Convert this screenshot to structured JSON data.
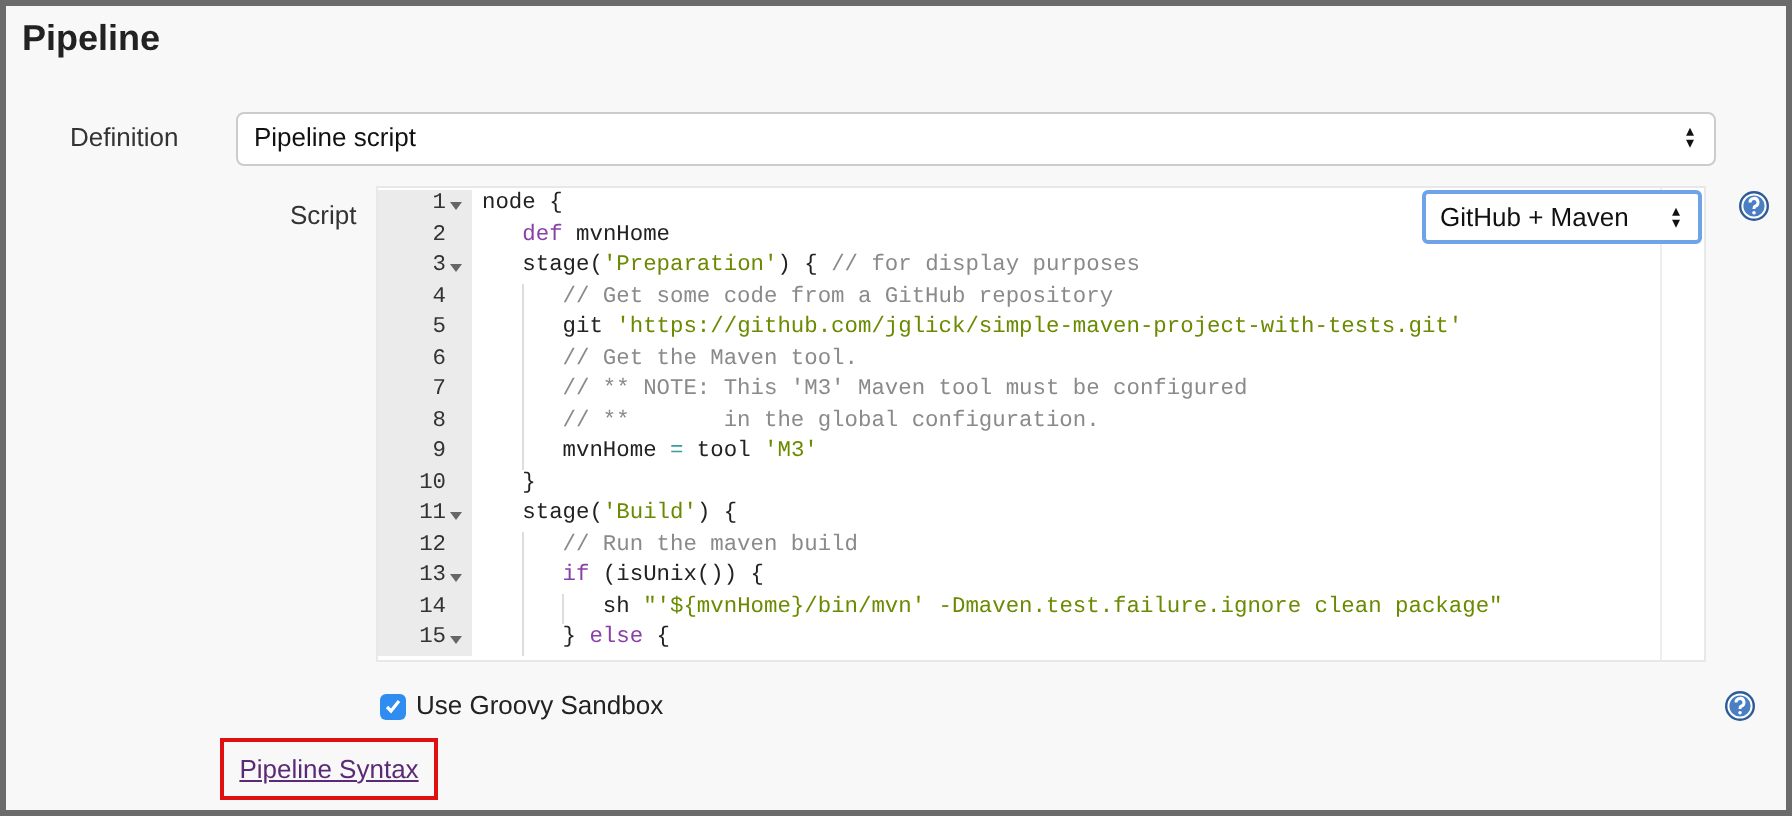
{
  "section": {
    "title": "Pipeline"
  },
  "definition": {
    "label": "Definition",
    "value": "Pipeline script",
    "arrows": "▴▾"
  },
  "script": {
    "label": "Script",
    "template": {
      "value": "GitHub + Maven"
    },
    "lines": [
      {
        "number": "1",
        "fold": true,
        "tokens": [
          {
            "kind": "plain",
            "text": "node {"
          }
        ],
        "children": [
          {
            "number": "2",
            "fold": false,
            "tokens": [
              {
                "kind": "keyword",
                "text": "def"
              },
              {
                "kind": "plain",
                "text": " mvnHome"
              }
            ]
          },
          {
            "number": "3",
            "fold": true,
            "tokens": [
              {
                "kind": "plain",
                "text": "stage("
              },
              {
                "kind": "string",
                "text": "'Preparation'"
              },
              {
                "kind": "plain",
                "text": ") { "
              },
              {
                "kind": "comment",
                "text": "// for display purposes"
              }
            ],
            "children": [
              {
                "number": "4",
                "fold": false,
                "tokens": [
                  {
                    "kind": "comment",
                    "text": "// Get some code from a GitHub repository"
                  }
                ]
              },
              {
                "number": "5",
                "fold": false,
                "tokens": [
                  {
                    "kind": "plain",
                    "text": "git "
                  },
                  {
                    "kind": "string",
                    "text": "'https://github.com/jglick/simple-maven-project-with-tests.git'"
                  }
                ]
              },
              {
                "number": "6",
                "fold": false,
                "tokens": [
                  {
                    "kind": "comment",
                    "text": "// Get the Maven tool."
                  }
                ]
              },
              {
                "number": "7",
                "fold": false,
                "tokens": [
                  {
                    "kind": "comment",
                    "text": "// ** NOTE: This 'M3' Maven tool must be configured"
                  }
                ]
              },
              {
                "number": "8",
                "fold": false,
                "tokens": [
                  {
                    "kind": "comment",
                    "text": "// **       in the global configuration."
                  }
                ]
              },
              {
                "number": "9",
                "fold": false,
                "tokens": [
                  {
                    "kind": "plain",
                    "text": "mvnHome "
                  },
                  {
                    "kind": "operator",
                    "text": "="
                  },
                  {
                    "kind": "plain",
                    "text": " tool "
                  },
                  {
                    "kind": "string",
                    "text": "'M3'"
                  }
                ]
              }
            ]
          },
          {
            "number": "10",
            "fold": false,
            "tokens": [
              {
                "kind": "plain",
                "text": "}"
              }
            ]
          },
          {
            "number": "11",
            "fold": true,
            "tokens": [
              {
                "kind": "plain",
                "text": "stage("
              },
              {
                "kind": "string",
                "text": "'Build'"
              },
              {
                "kind": "plain",
                "text": ") {"
              }
            ],
            "children": [
              {
                "number": "12",
                "fold": false,
                "tokens": [
                  {
                    "kind": "comment",
                    "text": "// Run the maven build"
                  }
                ]
              },
              {
                "number": "13",
                "fold": true,
                "tokens": [
                  {
                    "kind": "keyword",
                    "text": "if"
                  },
                  {
                    "kind": "plain",
                    "text": " (isUnix()) {"
                  }
                ],
                "children": [
                  {
                    "number": "14",
                    "fold": false,
                    "tokens": [
                      {
                        "kind": "plain",
                        "text": "sh "
                      },
                      {
                        "kind": "string",
                        "text": "\"'${mvnHome}/bin/mvn' -Dmaven.test.failure.ignore clean package\""
                      }
                    ]
                  }
                ]
              },
              {
                "number": "15",
                "fold": true,
                "tokens": [
                  {
                    "kind": "plain",
                    "text": "} "
                  },
                  {
                    "kind": "keyword",
                    "text": "else"
                  },
                  {
                    "kind": "plain",
                    "text": " {"
                  }
                ]
              }
            ]
          }
        ]
      }
    ]
  },
  "sandbox": {
    "label": "Use Groovy Sandbox",
    "checked": true
  },
  "syntax_link": {
    "label": "Pipeline Syntax"
  }
}
